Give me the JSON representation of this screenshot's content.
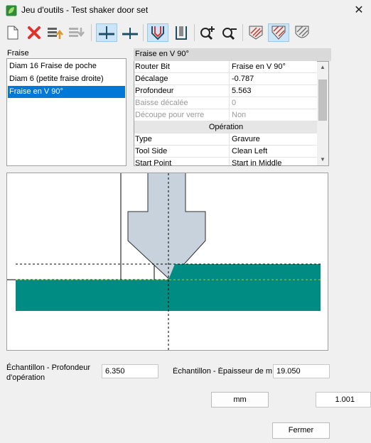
{
  "window": {
    "title": "Jeu d'outils - Test shaker door set",
    "close_glyph": "✕"
  },
  "toolbar": {
    "buttons": [
      {
        "icon": "new-document-icon"
      },
      {
        "icon": "delete-icon",
        "color": "#e0322d"
      },
      {
        "icon": "move-up-icon"
      },
      {
        "icon": "move-down-icon"
      },
      {
        "icon": "cut-profile-tee-icon"
      },
      {
        "icon": "cut-profile-cross-icon"
      },
      {
        "icon": "v-bit-icon"
      },
      {
        "icon": "straight-bit-icon"
      },
      {
        "icon": "zoom-in-icon"
      },
      {
        "icon": "zoom-out-icon"
      },
      {
        "icon": "hatch-bit-flat-icon"
      },
      {
        "icon": "hatch-bit-v-icon"
      },
      {
        "icon": "hatch-bit-ball-icon"
      }
    ]
  },
  "tool_list": {
    "label": "Fraise",
    "items": [
      "Diam 16 Fraise de poche",
      "Diam 6 (petite fraise droite)",
      "Fraise en V 90°"
    ],
    "selected": "Fraise en V 90°"
  },
  "properties": {
    "header": "Fraise en V 90°",
    "rows": [
      {
        "key": "Router Bit",
        "value": "Fraise en V 90°"
      },
      {
        "key": "Décalage",
        "value": "-0.787"
      },
      {
        "key": "Profondeur",
        "value": "5.563"
      },
      {
        "key": "Baisse décalée",
        "value": "0"
      },
      {
        "key": "Découpe pour verre",
        "value": "Non"
      }
    ],
    "section": "Opération",
    "op_rows": [
      {
        "key": "Type",
        "value": "Gravure"
      },
      {
        "key": "Tool Side",
        "value": "Clean Left"
      },
      {
        "key": "Start Point",
        "value": "Start in Middle"
      }
    ]
  },
  "preview": {
    "bit_color": "#c7d2dc",
    "material_color": "#008b83",
    "guide_color": "#c8c800"
  },
  "bottom": {
    "depth_label": "Échantillon - Profondeur d'opération",
    "depth_value": "6.350",
    "thickness_label": "Échantillon - Épaisseur de m",
    "thickness_value": "19.050",
    "units": "mm",
    "scale": "1.001",
    "close_label": "Fermer"
  }
}
